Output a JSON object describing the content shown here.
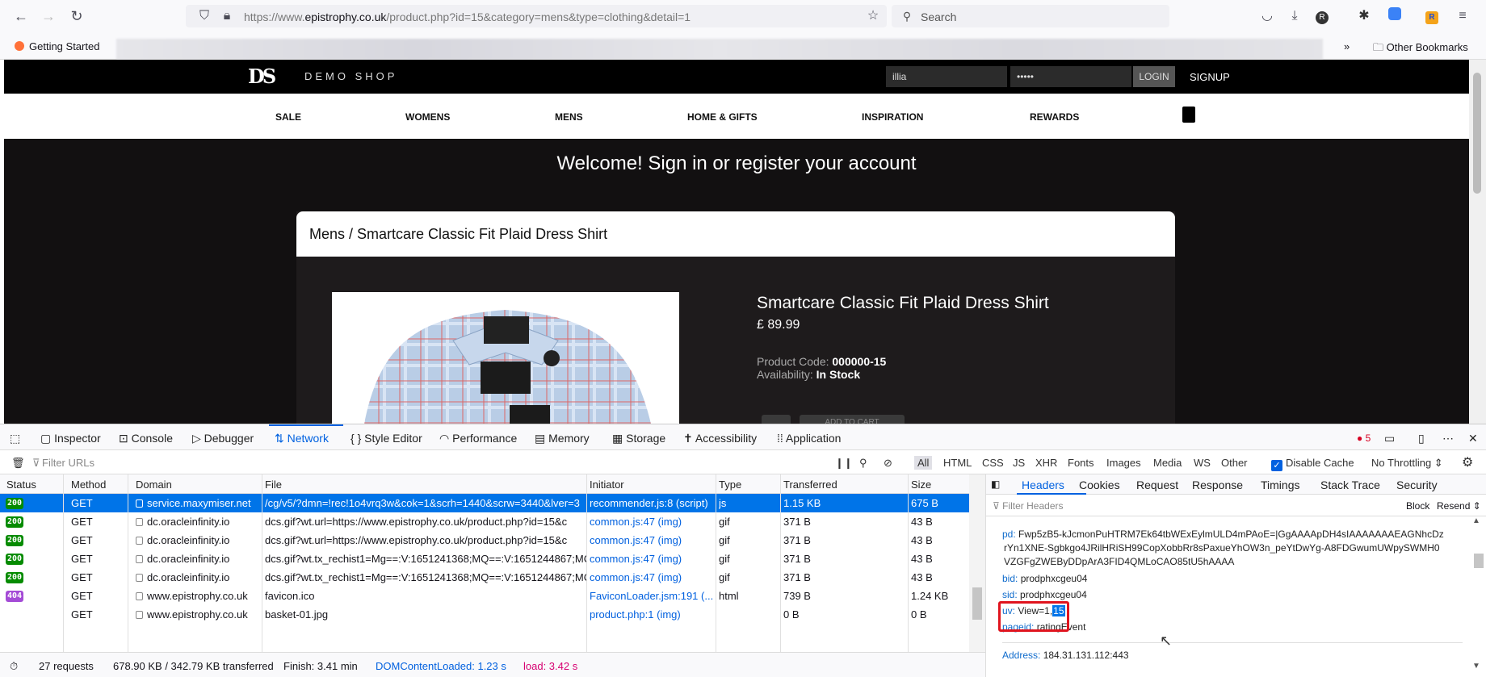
{
  "browser": {
    "url_prefix": "https://www.",
    "url_domain": "epistrophy.co.uk",
    "url_path": "/product.php?id=15&category=mens&type=clothing&detail=1",
    "search_placeholder": "Search",
    "bookmarks": {
      "getting_started": "Getting Started",
      "other_bookmarks": "Other Bookmarks"
    }
  },
  "site": {
    "logo": "DS",
    "shop_name": "DEMO SHOP",
    "username_value": "illia",
    "password_value": "•••••",
    "login_label": "LOGIN",
    "signup_label": "SIGNUP",
    "nav": [
      "SALE",
      "WOMENS",
      "MENS",
      "HOME & GIFTS",
      "INSPIRATION",
      "REWARDS"
    ],
    "welcome": "Welcome! Sign in or register your account",
    "breadcrumb": "Mens / Smartcare Classic Fit Plaid Dress Shirt",
    "product": {
      "name": "Smartcare Classic Fit Plaid Dress Shirt",
      "price": "£ 89.99",
      "code_label": "Product Code:",
      "code": "000000-15",
      "availability_label": "Availability:",
      "availability": "In Stock",
      "add_to_cart": "ADD TO CART"
    }
  },
  "devtools": {
    "tabs": [
      "Inspector",
      "Console",
      "Debugger",
      "Network",
      "Style Editor",
      "Performance",
      "Memory",
      "Storage",
      "Accessibility",
      "Application"
    ],
    "error_count": "5",
    "filter_placeholder": "Filter URLs",
    "types": [
      "All",
      "HTML",
      "CSS",
      "JS",
      "XHR",
      "Fonts",
      "Images",
      "Media",
      "WS",
      "Other"
    ],
    "disable_cache": "Disable Cache",
    "throttling": "No Throttling ⇕",
    "columns": [
      "Status",
      "Method",
      "Domain",
      "File",
      "Initiator",
      "Type",
      "Transferred",
      "Size"
    ],
    "requests": [
      {
        "status": "200",
        "method": "GET",
        "domain": "service.maxymiser.net",
        "file": "/cg/v5/?dmn=!rec!1o4vrq3w&cok=1&scrh=1440&scrw=3440&lver=3",
        "initiator": "recommender.js:8 (script)",
        "type": "js",
        "transferred": "1.15 KB",
        "size": "675 B"
      },
      {
        "status": "200",
        "method": "GET",
        "domain": "dc.oracleinfinity.io",
        "file": "dcs.gif?wt.url=https://www.epistrophy.co.uk/product.php?id=15&c",
        "initiator": "common.js:47 (img)",
        "type": "gif",
        "transferred": "371 B",
        "size": "43 B"
      },
      {
        "status": "200",
        "method": "GET",
        "domain": "dc.oracleinfinity.io",
        "file": "dcs.gif?wt.url=https://www.epistrophy.co.uk/product.php?id=15&c",
        "initiator": "common.js:47 (img)",
        "type": "gif",
        "transferred": "371 B",
        "size": "43 B"
      },
      {
        "status": "200",
        "method": "GET",
        "domain": "dc.oracleinfinity.io",
        "file": "dcs.gif?wt.tx_rechist1=Mg==:V:1651241368;MQ==:V:1651244867;MC",
        "initiator": "common.js:47 (img)",
        "type": "gif",
        "transferred": "371 B",
        "size": "43 B"
      },
      {
        "status": "200",
        "method": "GET",
        "domain": "dc.oracleinfinity.io",
        "file": "dcs.gif?wt.tx_rechist1=Mg==:V:1651241368;MQ==:V:1651244867;MC",
        "initiator": "common.js:47 (img)",
        "type": "gif",
        "transferred": "371 B",
        "size": "43 B"
      },
      {
        "status": "404",
        "method": "GET",
        "domain": "www.epistrophy.co.uk",
        "file": "favicon.ico",
        "initiator": "FaviconLoader.jsm:191 (...",
        "type": "html",
        "transferred": "739 B",
        "size": "1.24 KB"
      },
      {
        "status": "",
        "method": "GET",
        "domain": "www.epistrophy.co.uk",
        "file": "basket-01.jpg",
        "initiator": "product.php:1 (img)",
        "type": "",
        "transferred": "0 B",
        "size": "0 B"
      }
    ],
    "summary": {
      "requests": "27 requests",
      "transferred": "678.90 KB / 342.79 KB transferred",
      "finish": "Finish: 3.41 min",
      "dcl": "DOMContentLoaded: 1.23 s",
      "load": "load: 3.42 s"
    },
    "side_tabs": [
      "Headers",
      "Cookies",
      "Request",
      "Response",
      "Timings",
      "Stack Trace",
      "Security"
    ],
    "filter_headers": "Filter Headers",
    "block": "Block",
    "resend": "Resend ⇕",
    "headers": {
      "pd_key": "pd:",
      "pd_1": "Fwp5zB5-kJcmonPuHTRM7Ek64tbWExEylmULD4mPAoE=|GgAAAApDH4sIAAAAAAAEAGNhcDz",
      "pd_2": "rYn1XNE-Sgbkgo4JRilHRiSH99CopXobbRr8sPaxueYhOW3n_peYtDwYg-A8FDGwumUWpySWMH0",
      "pd_3": "VZGFgZWEByDDpArA3FID4QMLoCAO85tU5hAAAA",
      "bid_key": "bid:",
      "bid": "prodphxcgeu04",
      "sid_key": "sid:",
      "sid": "prodphxcgeu04",
      "uv_key": "uv:",
      "uv_prefix": "View=1,",
      "uv_selected": "15",
      "pageid_key": "pageid:",
      "pageid": "ratingEvent",
      "address_key": "Address:",
      "address": "184.31.131.112:443"
    }
  }
}
